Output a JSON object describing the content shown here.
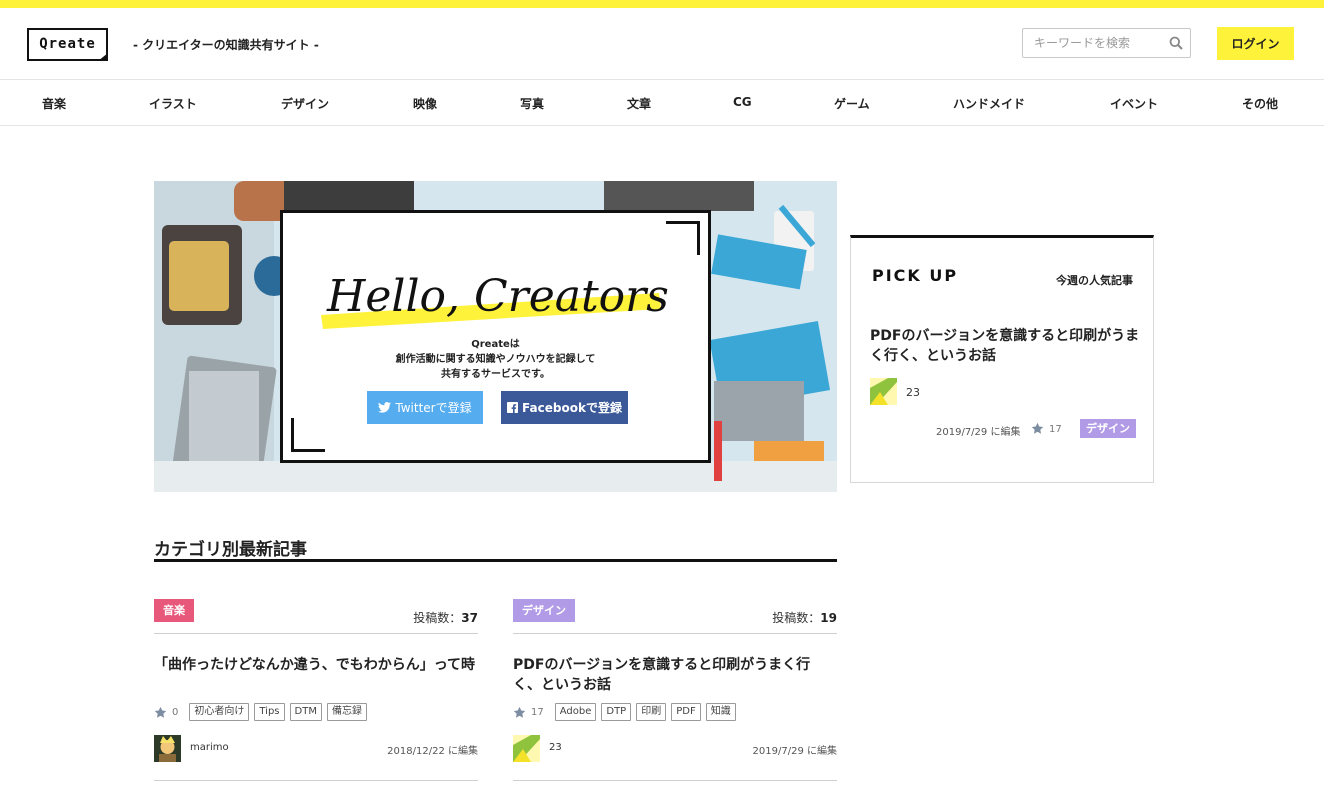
{
  "header": {
    "logo": "Qreate",
    "tagline": "- クリエイターの知識共有サイト -",
    "search_placeholder": "キーワードを検索",
    "login_label": "ログイン"
  },
  "nav": {
    "items": [
      {
        "label": "音楽"
      },
      {
        "label": "イラスト"
      },
      {
        "label": "デザイン"
      },
      {
        "label": "映像"
      },
      {
        "label": "写真"
      },
      {
        "label": "文章"
      },
      {
        "label": "CG"
      },
      {
        "label": "ゲーム"
      },
      {
        "label": "ハンドメイド"
      },
      {
        "label": "イベント"
      },
      {
        "label": "その他"
      }
    ]
  },
  "hero": {
    "headline": "Hello, Creators!",
    "line1": "Qreateは",
    "line2": "創作活動に関する知識やノウハウを記録して",
    "line3": "共有するサービスです。",
    "twitter_label": "Twitterで登録",
    "facebook_label": "Facebookで登録"
  },
  "pickup": {
    "title": "PICK UP",
    "subtitle": "今週の人気記事",
    "article_title": "PDFのバージョンを意識すると印刷がうまく行く、というお話",
    "author_count": "23",
    "date": "2019/7/29 に編集",
    "stars": "17",
    "tag": "デザイン"
  },
  "section": {
    "title": "カテゴリ別最新記事"
  },
  "columns": [
    {
      "tag": "音楽",
      "tag_color": "#e8587a",
      "count_label": "投稿数：",
      "count": "37",
      "title": "「曲作ったけどなんか違う、でもわからん」って時",
      "stars": "0",
      "chips": [
        "初心者向け",
        "Tips",
        "DTM",
        "備忘録"
      ],
      "author": "marimo",
      "date": "2018/12/22 に編集"
    },
    {
      "tag": "デザイン",
      "tag_color": "#b29be6",
      "count_label": "投稿数：",
      "count": "19",
      "title": "PDFのバージョンを意識すると印刷がうまく行く、というお話",
      "stars": "17",
      "chips": [
        "Adobe",
        "DTP",
        "印刷",
        "PDF",
        "知識"
      ],
      "author": "23",
      "date": "2019/7/29 に編集"
    }
  ],
  "colors": {
    "accent": "#fff23a",
    "twitter": "#55acee",
    "facebook": "#3b5998",
    "dark": "#111111"
  }
}
